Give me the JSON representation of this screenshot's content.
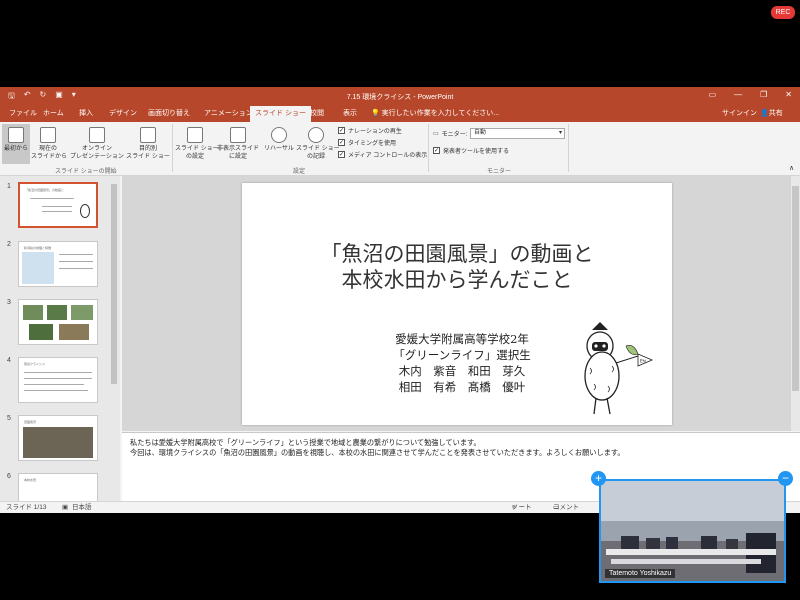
{
  "recording_badge": "REC",
  "window": {
    "title": "7.15 環境クライシス - PowerPoint",
    "tabs": [
      "ファイル",
      "ホーム",
      "挿入",
      "デザイン",
      "画面切り替え",
      "アニメーション",
      "スライド ショー",
      "校閲",
      "表示"
    ],
    "tell_me": "実行したい作業を入力してください...",
    "sign_in": "サインイン",
    "share": "共有"
  },
  "ribbon": {
    "from_beginning": "最初から",
    "from_current_line1": "現在の",
    "from_current_line2": "スライドから",
    "online_line1": "オンライン",
    "online_line2": "プレゼンテーション",
    "custom_line1": "目的別",
    "custom_line2": "スライド ショー",
    "group_start": "スライド ショーの開始",
    "setup_line1": "スライド ショー",
    "setup_line2": "の設定",
    "hide_line1": "非表示スライド",
    "hide_line2": "に設定",
    "rehearse": "リハーサル",
    "record_line1": "スライド ショー",
    "record_line2": "の記録",
    "narration": "ナレーションの再生",
    "timings": "タイミングを使用",
    "media_controls": "メディア コントロールの表示",
    "group_setup": "設定",
    "monitor_label": "モニター:",
    "monitor_value": "自動",
    "presenter_view": "発表者ツールを使用する",
    "group_monitor": "モニター"
  },
  "thumbnails": [
    {
      "num": "1",
      "caption": "「魚沼の田園風景」の動画と"
    },
    {
      "num": "2",
      "caption": "新潟県の地理と特徴"
    },
    {
      "num": "3",
      "caption": "写真"
    },
    {
      "num": "4",
      "caption": "環境クライシス"
    },
    {
      "num": "5",
      "caption": "田園風景"
    },
    {
      "num": "6",
      "caption": "本校水田"
    }
  ],
  "slide": {
    "title_line1": "「魚沼の田園風景」の動画と",
    "title_line2": "本校水田から学んだこと",
    "sub_line1": "愛媛大学附属高等学校2年",
    "sub_line2": "「グリーンライフ」選択生",
    "sub_line3": "木内　紫音　和田　芽久",
    "sub_line4": "相田　有希　髙橋　優叶",
    "flag_text": "Ehi"
  },
  "notes": {
    "line1": "私たちは愛媛大学附属高校で「グリーンライフ」という授業で地域と農業の繋がりについて勉強しています。",
    "line2": "今回は、環境クライシスの「魚沼の田園風景」の動画を視聴し、本校の水田に関連させて学んだことを発表させていただきます。よろしくお願いします。"
  },
  "status": {
    "slide_count": "スライド 1/13",
    "language": "日本語",
    "notes": "ノート",
    "comments": "コメント"
  },
  "video": {
    "participant": "Tatemoto Yoshikazu"
  },
  "colors": {
    "accent": "#b7472a",
    "video_border": "#2196f3"
  }
}
